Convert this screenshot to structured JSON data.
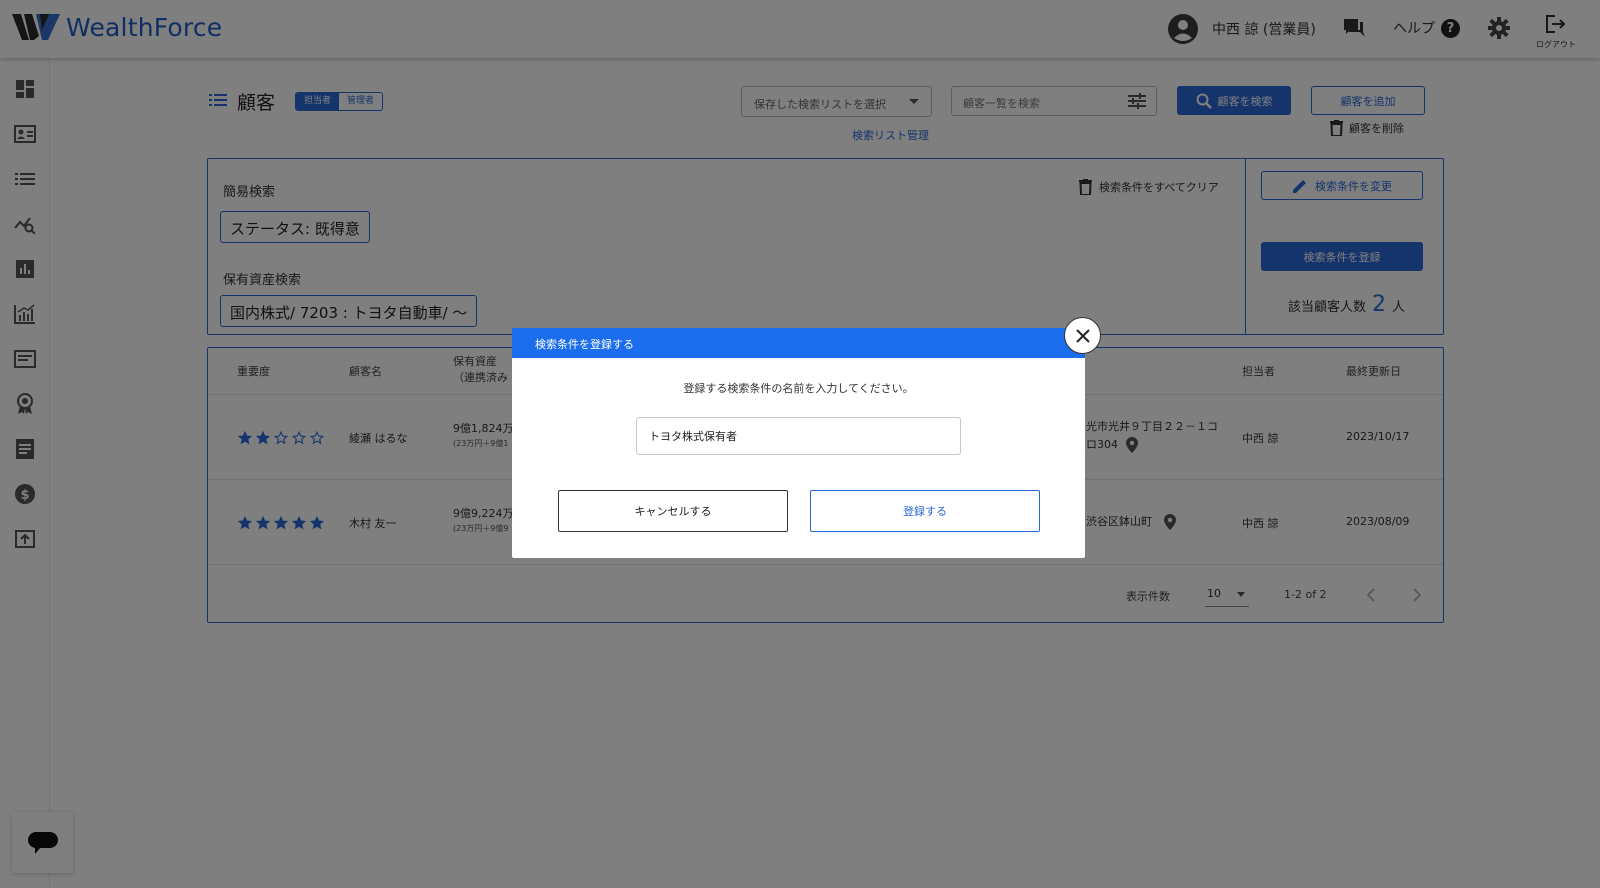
{
  "header": {
    "logo_text": "WealthForce",
    "user_name": "中西 諒 (営業員)",
    "help_label": "ヘルプ",
    "help_glyph": "?",
    "logout_label": "ログアウト"
  },
  "page": {
    "title": "顧客",
    "role_toggle": {
      "active": "担当者",
      "inactive": "管理者"
    },
    "saved_search_placeholder": "保存した検索リストを選択",
    "list_manage_link": "検索リスト管理",
    "search_placeholder": "顧客一覧を検索",
    "search_button": "顧客を検索",
    "add_button": "顧客を追加",
    "delete_button": "顧客を削除"
  },
  "search_panel": {
    "simple_label": "簡易検索",
    "status_chip": "ステータス: 既得意",
    "asset_label": "保有資産検索",
    "asset_chip": "国内株式/ 7203 : トヨタ自動車/ ～",
    "clear_all": "検索条件をすべてクリア",
    "change_button": "検索条件を変更",
    "register_button": "検索条件を登録",
    "count_label": "該当顧客人数",
    "count_value": "2",
    "count_unit": "人"
  },
  "table": {
    "headers": {
      "importance": "重要度",
      "name": "顧客名",
      "assets_line1": "保有資産",
      "assets_line2": "（連携済み",
      "owner": "担当者",
      "updated": "最終更新日"
    },
    "rows": [
      {
        "stars_filled": 2,
        "stars_total": 5,
        "name": "綾瀬 はるな",
        "assets": "9億1,824万円",
        "assets_sub": "(23万円＋9億1",
        "address_line1": "光市光井９丁目２２－１コ",
        "address_line2": "ロ304",
        "owner": "中西 諒",
        "updated": "2023/10/17"
      },
      {
        "stars_filled": 5,
        "stars_total": 5,
        "name": "木村 友一",
        "assets": "9億9,224万円",
        "assets_sub": "(23万円＋9億9",
        "address_line1": "渋谷区鉢山町",
        "address_line2": "",
        "owner": "中西 諒",
        "updated": "2023/08/09"
      }
    ],
    "pager": {
      "per_page_label": "表示件数",
      "per_page_value": "10",
      "range": "1-2 of 2"
    }
  },
  "modal": {
    "title": "検索条件を登録する",
    "message": "登録する検索条件の名前を入力してください。",
    "input_value": "トヨタ株式保有者",
    "cancel_label": "キャンセルする",
    "submit_label": "登録する"
  },
  "colors": {
    "primary": "#2a68d8",
    "modal_header": "#1b6dee",
    "overlay": "#000000"
  },
  "icons": {
    "header": [
      "user-avatar-icon",
      "chat-icon",
      "help-icon",
      "gear-icon",
      "logout-icon"
    ],
    "sidebar": [
      "dashboard-icon",
      "contact-card-icon",
      "list-icon",
      "analytics-search-icon",
      "bar-chart-icon",
      "growth-chart-icon",
      "message-board-icon",
      "ribbon-icon",
      "document-icon",
      "dollar-icon",
      "export-icon"
    ]
  }
}
